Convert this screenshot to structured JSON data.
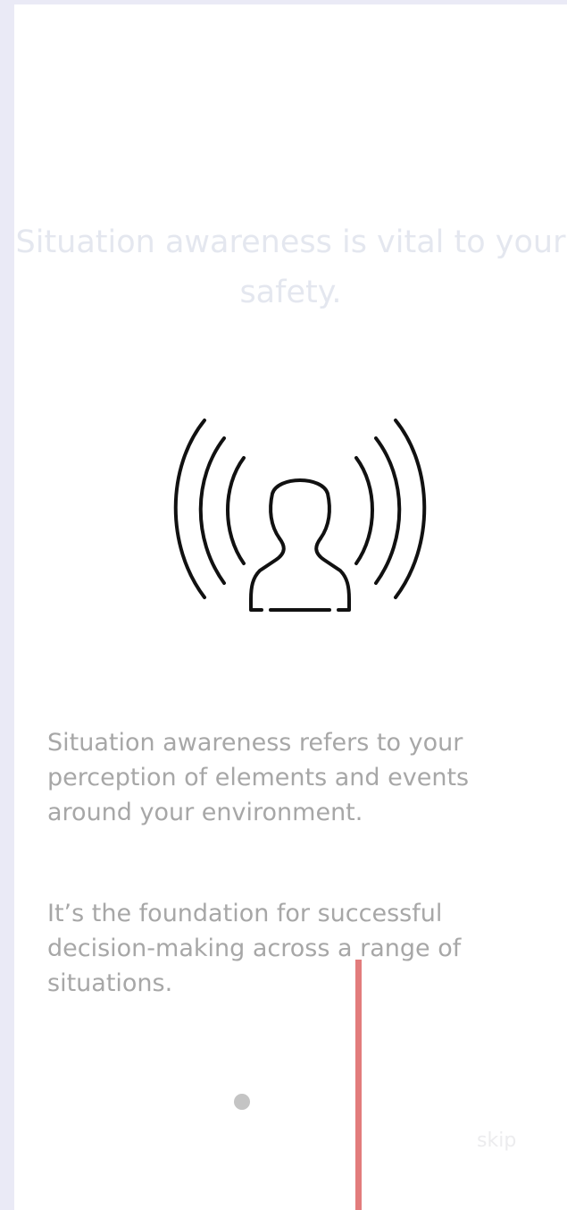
{
  "onboarding": {
    "headline": "Situation awareness is vital to your safety.",
    "illustration_icon": "person-broadcast-icon",
    "paragraph_1": "Situation awareness refers to your perception of elements and events around your environment.",
    "paragraph_2": "It’s the foundation for successful decision-making across a range of situations.",
    "skip_label": "skip"
  },
  "colors": {
    "page_background": "#eaeaf6",
    "screen_background": "#ffffff",
    "headline": "#e4e7ef",
    "body_text": "#a7a7a7",
    "page_dot": "#c4c4c4",
    "skip": "#ececee",
    "indicator": "#e27c7c"
  }
}
